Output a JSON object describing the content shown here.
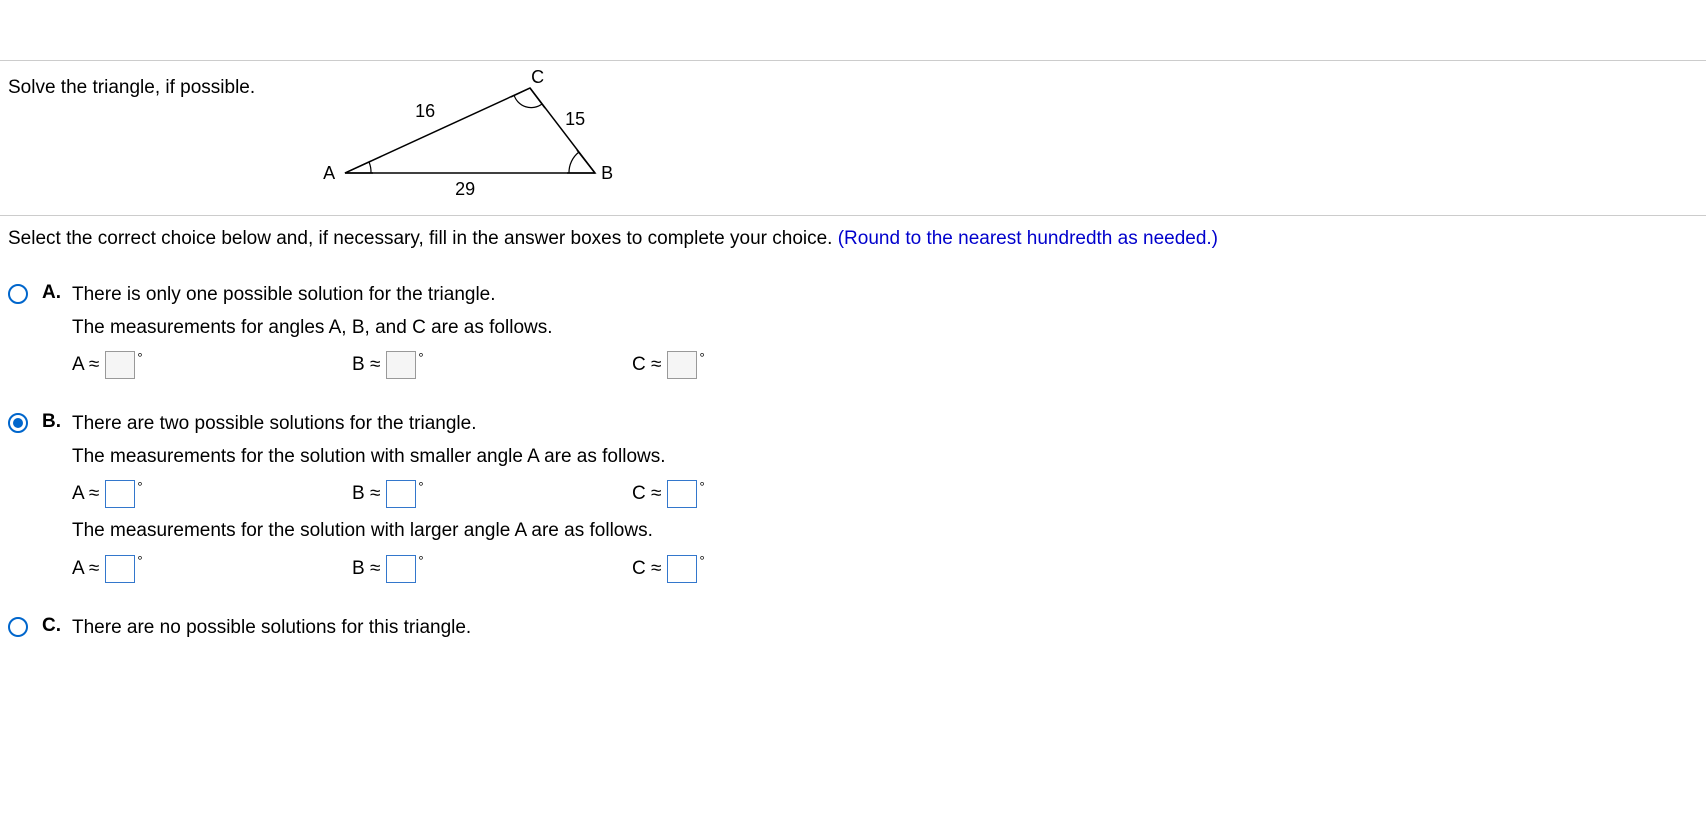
{
  "problem": {
    "prompt": "Solve the triangle, if possible.",
    "triangle": {
      "vertexA": "A",
      "vertexB": "B",
      "vertexC": "C",
      "sideAC": "16",
      "sideBC": "15",
      "sideAB": "29"
    }
  },
  "instruction": {
    "text": "Select the correct choice below and, if necessary, fill in the answer boxes to complete your choice. ",
    "note": "(Round to the nearest hundredth as needed.)"
  },
  "choices": {
    "a": {
      "letter": "A.",
      "line1": "There is only one possible solution for the triangle.",
      "line2": "The measurements for angles A, B, and C are as follows.",
      "varA": "A ≈",
      "varB": "B ≈",
      "varC": "C ≈",
      "deg": "°"
    },
    "b": {
      "letter": "B.",
      "line1": "There are two possible solutions for the triangle.",
      "line2": "The measurements for the solution with smaller angle A are as follows.",
      "line3": "The measurements for the solution with larger angle A are as follows.",
      "varA": "A ≈",
      "varB": "B ≈",
      "varC": "C ≈",
      "deg": "°"
    },
    "c": {
      "letter": "C.",
      "line1": "There are no possible solutions for this triangle."
    }
  }
}
